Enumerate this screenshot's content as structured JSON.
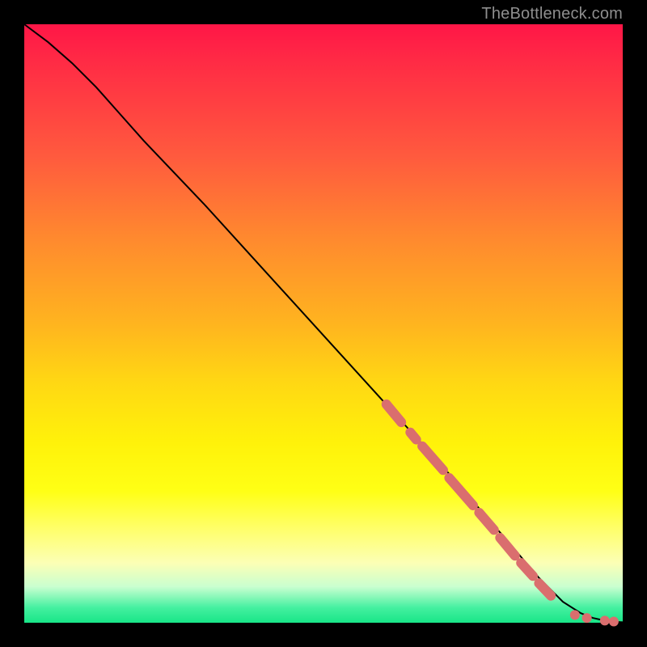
{
  "watermark": "TheBottleneck.com",
  "colors": {
    "dot": "#da6e6e",
    "curve": "#000000"
  },
  "chart_data": {
    "type": "line",
    "title": "",
    "xlabel": "",
    "ylabel": "",
    "xlim": [
      0,
      100
    ],
    "ylim": [
      0,
      100
    ],
    "grid": false,
    "series": [
      {
        "name": "curve",
        "x": [
          0,
          4,
          8,
          12,
          16,
          20,
          30,
          40,
          50,
          60,
          70,
          80,
          86,
          90,
          93,
          95,
          97,
          98.5,
          100
        ],
        "y": [
          100,
          97,
          93.5,
          89.5,
          85,
          80.5,
          70,
          59,
          48,
          37,
          26,
          14.5,
          7.5,
          3.5,
          1.6,
          0.8,
          0.35,
          0.15,
          0.08
        ]
      }
    ],
    "highlight_segments": [
      {
        "x1": 60.5,
        "y1": 36.5,
        "x2": 63.0,
        "y2": 33.5
      },
      {
        "x1": 64.5,
        "y1": 31.8,
        "x2": 65.5,
        "y2": 30.6
      },
      {
        "x1": 66.5,
        "y1": 29.5,
        "x2": 70.0,
        "y2": 25.5
      },
      {
        "x1": 71.0,
        "y1": 24.2,
        "x2": 75.0,
        "y2": 19.6
      },
      {
        "x1": 76.0,
        "y1": 18.4,
        "x2": 78.5,
        "y2": 15.5
      },
      {
        "x1": 79.5,
        "y1": 14.2,
        "x2": 82.0,
        "y2": 11.2
      },
      {
        "x1": 83.0,
        "y1": 10.0,
        "x2": 85.0,
        "y2": 7.8
      },
      {
        "x1": 86.0,
        "y1": 6.6,
        "x2": 88.0,
        "y2": 4.5
      }
    ],
    "highlight_points": [
      {
        "x": 92.0,
        "y": 1.3
      },
      {
        "x": 94.0,
        "y": 0.8
      },
      {
        "x": 97.0,
        "y": 0.35
      },
      {
        "x": 98.5,
        "y": 0.2
      }
    ]
  }
}
